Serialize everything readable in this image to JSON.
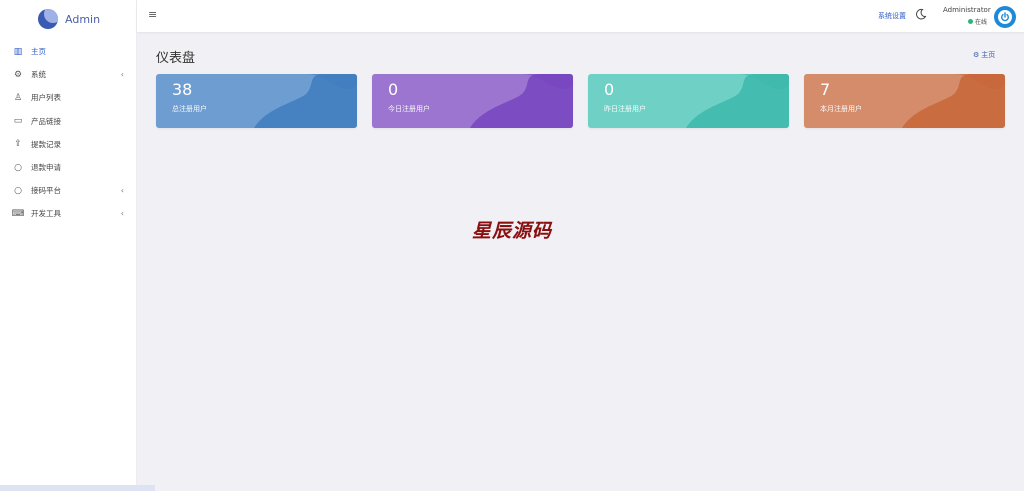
{
  "brand": {
    "name": "Admin"
  },
  "sidebar": {
    "items": [
      {
        "label": "主页",
        "icon": "chart-icon",
        "active": true,
        "has_arrow": false
      },
      {
        "label": "系统",
        "icon": "gear-icon",
        "active": false,
        "has_arrow": true
      },
      {
        "label": "用户列表",
        "icon": "user-icon",
        "active": false,
        "has_arrow": false
      },
      {
        "label": "产品链接",
        "icon": "monitor-icon",
        "active": false,
        "has_arrow": false
      },
      {
        "label": "提款记录",
        "icon": "export-icon",
        "active": false,
        "has_arrow": false
      },
      {
        "label": "退款申请",
        "icon": "circle-icon",
        "active": false,
        "has_arrow": false
      },
      {
        "label": "接码平台",
        "icon": "circle-icon",
        "active": false,
        "has_arrow": true
      },
      {
        "label": "开发工具",
        "icon": "keyboard-icon",
        "active": false,
        "has_arrow": true
      }
    ],
    "arrow": "‹"
  },
  "header": {
    "menu_icon": "≡",
    "settings_label": "系统设置",
    "user_name": "Administrator",
    "status": "在线"
  },
  "main": {
    "title": "仪表盘",
    "breadcrumb": "主页",
    "cards": [
      {
        "value": "38",
        "label": "总注册用户",
        "color": "#6e9ed1",
        "accent": "#3f7cc0"
      },
      {
        "value": "0",
        "label": "今日注册用户",
        "color": "#9b75cf",
        "accent": "#7745bf"
      },
      {
        "value": "0",
        "label": "昨日注册用户",
        "color": "#6fd0c6",
        "accent": "#3db8ab"
      },
      {
        "value": "7",
        "label": "本月注册用户",
        "color": "#d48c6b",
        "accent": "#c76638"
      }
    ]
  },
  "watermark": "星辰源码"
}
